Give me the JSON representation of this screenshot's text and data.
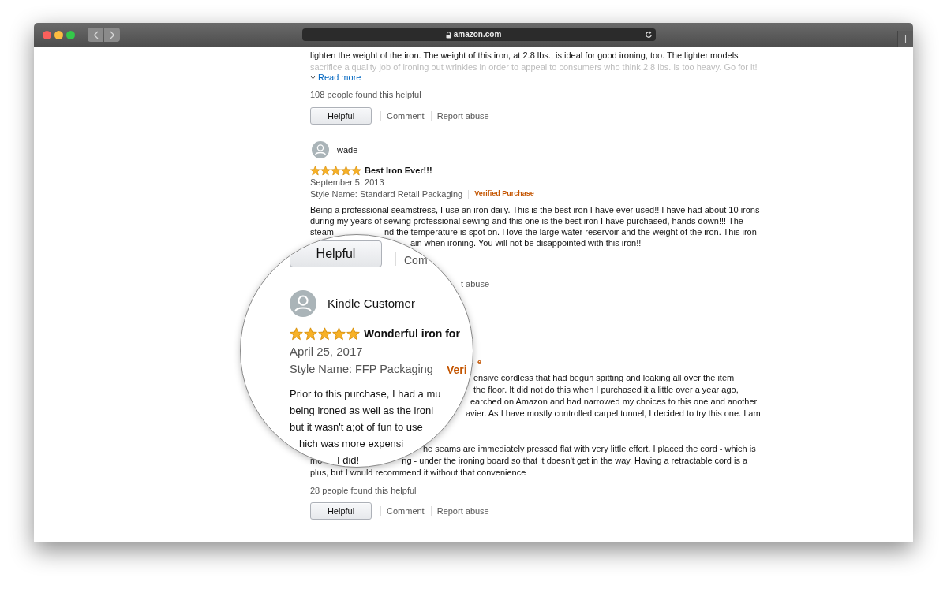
{
  "browser": {
    "url": "amazon.com"
  },
  "top_review": {
    "body_lines": [
      "lighten the weight of the iron. The weight of this iron, at 2.8 lbs., is ideal for good ironing, too. The lighter models",
      "sacrifice a quality job of ironing out wrinkles in order to appeal to consumers who think 2.8 lbs. is too heavy. Go for it!"
    ],
    "read_more": "Read more",
    "helpful_count": "108 people found this helpful",
    "helpful_button": "Helpful",
    "links": [
      "Comment",
      "Report abuse"
    ]
  },
  "second_review": {
    "reviewer": "wade",
    "stars": 5,
    "title": "Best Iron Ever!!!",
    "date": "September 5, 2013",
    "style_name": "Style Name: Standard Retail Packaging",
    "badge": "Verified Purchase",
    "body_lines": [
      [
        "Being a professional seamstress, I use an iron daily. This is the best iron I have ever used!! I have had about 10 irons"
      ],
      [
        "during my years of sewing professional sewing and this one is the best iron I have purchased, hands down!!! The"
      ],
      [
        "steam",
        "nd the temperature is spot on. I love the large water reservoir and the weight of the iron. This iron"
      ],
      [
        "ain when ironing. You will not be disappointed with this iron!!"
      ]
    ],
    "link_fragment": "t abuse"
  },
  "third_review": {
    "badge_fragment": "e",
    "body_lines": [
      [
        "ensive cordless that had begun spitting and leaking all over the item"
      ],
      [
        "the floor. It did not do this when I purchased it a little over a year ago,"
      ],
      [
        "earched on Amazon and had narrowed my choices to this one and another"
      ],
      [
        "avier. As I have mostly controlled carpel tunnel, I decided to try this one. I am"
      ],
      [
        "he seams are immediately pressed flat with very little effort. I placed the cord - which is"
      ],
      [
        "mo",
        "ng - under the ironing board so that it doesn't get in the way. Having a retractable cord is a"
      ],
      [
        "plus, but I would recommend it without that convenience"
      ]
    ],
    "helpful_count": "28 people found this helpful",
    "helpful_button": "Helpful",
    "links": [
      "Comment",
      "Report abuse"
    ]
  },
  "magnifier": {
    "helpful_button": "Helpful",
    "link_fragment": "Com",
    "reviewer": "Kindle Customer",
    "stars": 5,
    "title": "Wonderful iron for",
    "date": "April 25, 2017",
    "style_name": "Style Name: FFP Packaging",
    "badge_fragment": "Veri",
    "body_lines": [
      "Prior to this purchase, I had a mu",
      "being ironed as well as the ironi",
      "but it wasn't a;ot of fun to use",
      "hich was more expensi",
      "I did!"
    ]
  }
}
